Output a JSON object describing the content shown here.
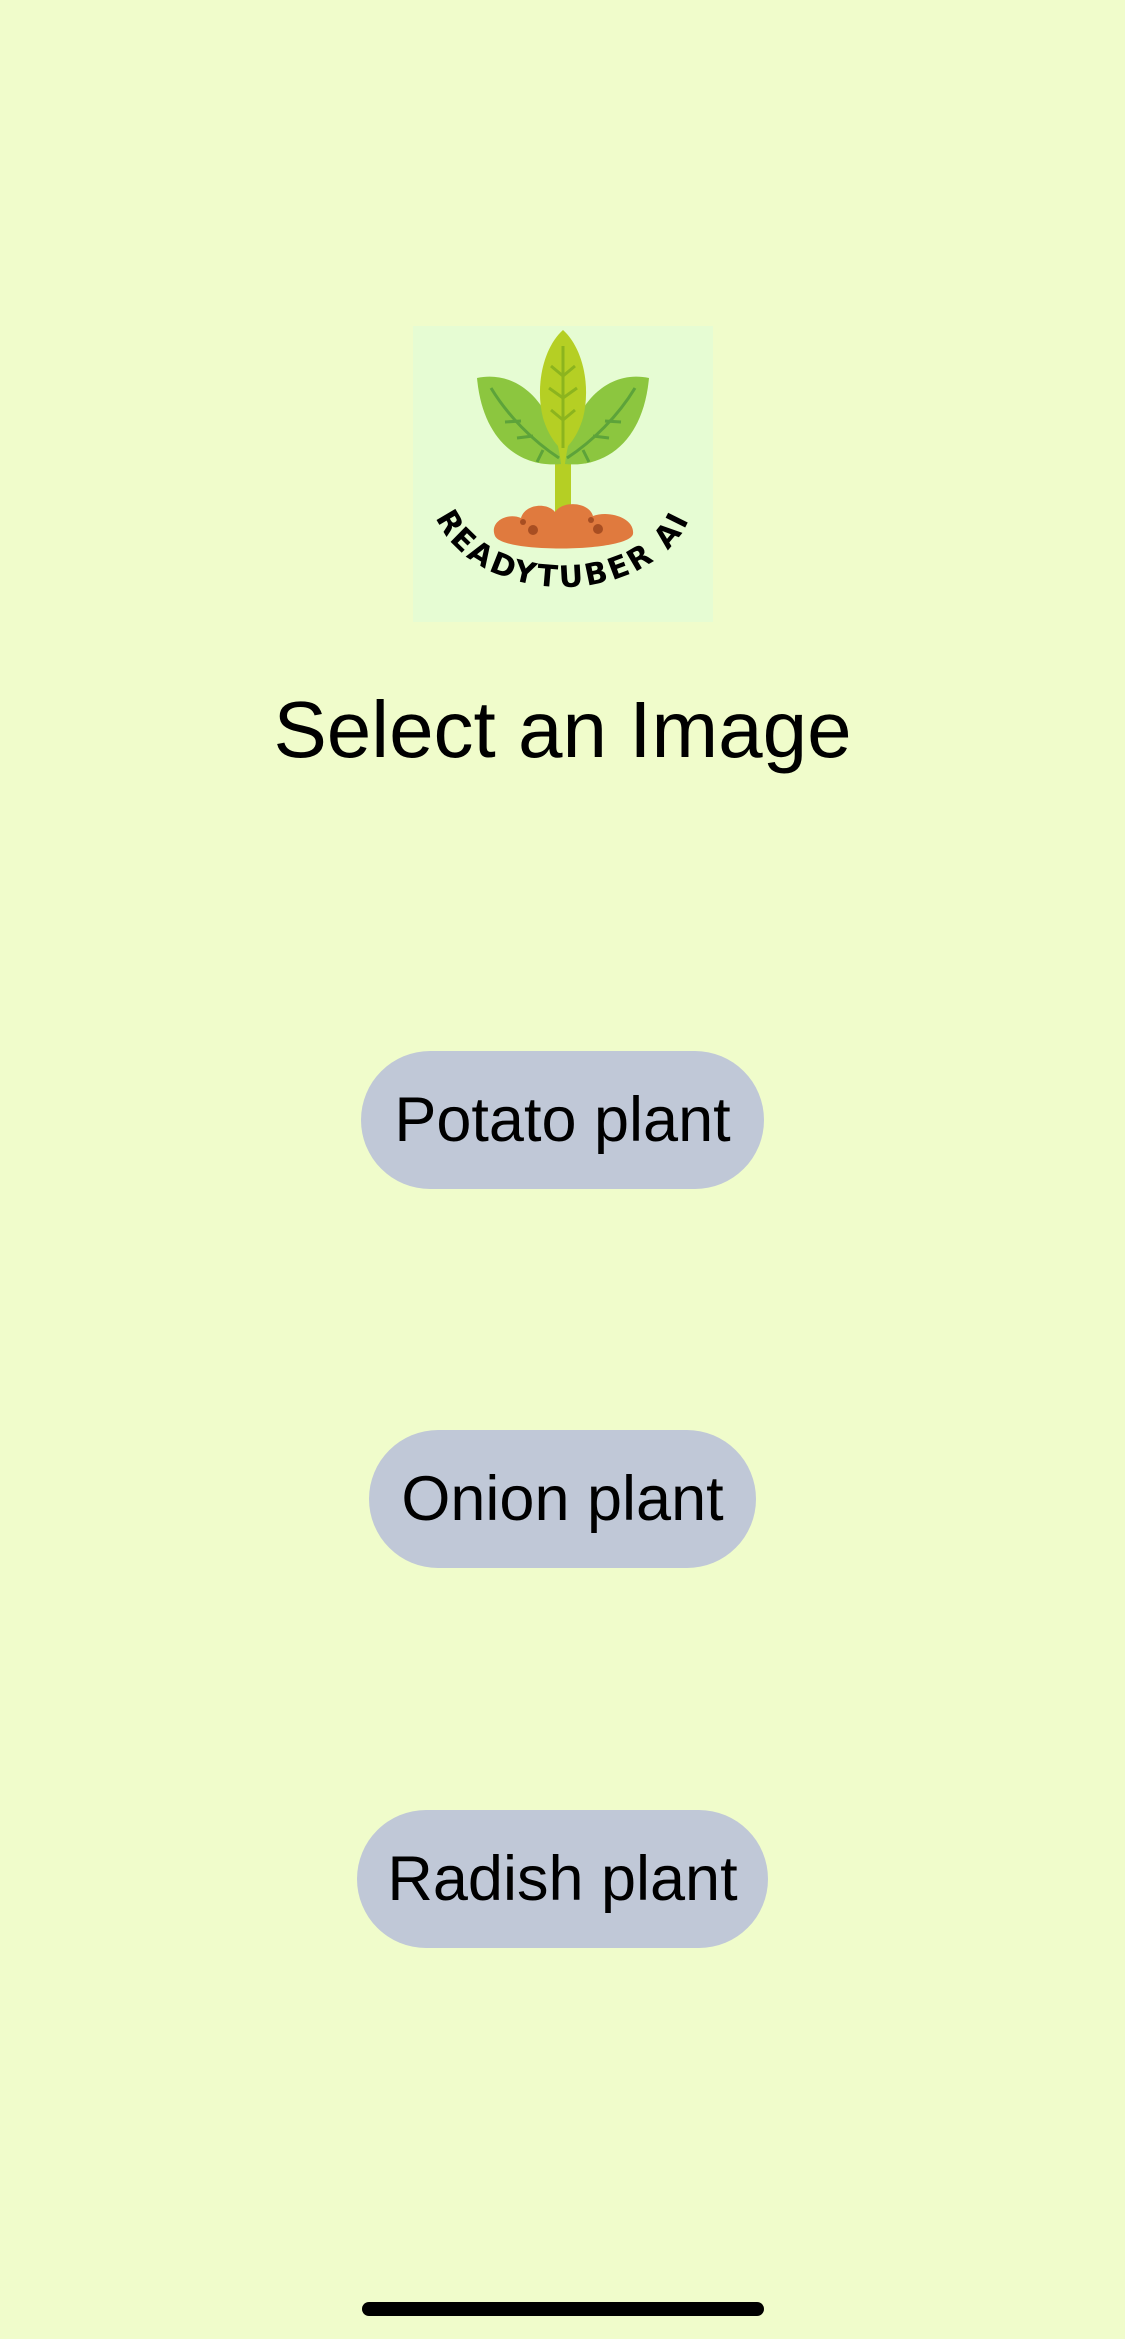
{
  "app": {
    "logo_text": "READYTUBER AI",
    "title": "Select an Image"
  },
  "options": [
    {
      "label": "Potato plant"
    },
    {
      "label": "Onion plant"
    },
    {
      "label": "Radish plant"
    }
  ],
  "colors": {
    "background": "#f0fccb",
    "logo_background": "#e6fcd3",
    "button": "#c0c8d7",
    "leaf_center": "#b5cf24",
    "leaf_side": "#8cc63f",
    "leaf_vein": "#5da33a",
    "soil": "#e07a3e",
    "text": "#000000"
  },
  "icons": {
    "logo": "sprout-in-soil-icon"
  }
}
